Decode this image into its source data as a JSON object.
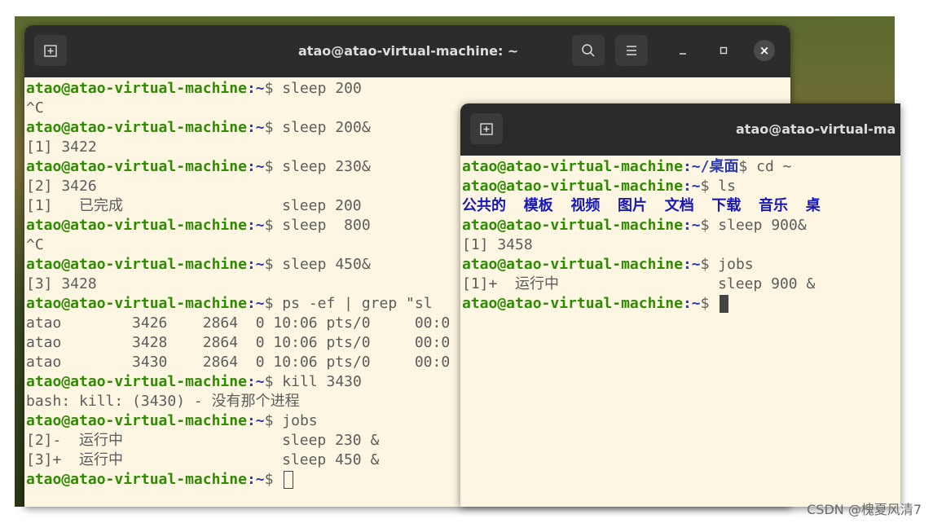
{
  "window1": {
    "title": "atao@atao-virtual-machine: ~",
    "lines": [
      {
        "user": "atao@atao-virtual-machine",
        "path": ":~",
        "cmd": "$ sleep 200"
      },
      {
        "text": "^C"
      },
      {
        "user": "atao@atao-virtual-machine",
        "path": ":~",
        "cmd": "$ sleep 200&"
      },
      {
        "text": "[1] 3422"
      },
      {
        "user": "atao@atao-virtual-machine",
        "path": ":~",
        "cmd": "$ sleep 230&"
      },
      {
        "text": "[2] 3426"
      },
      {
        "text": "[1]   已完成                  sleep 200"
      },
      {
        "user": "atao@atao-virtual-machine",
        "path": ":~",
        "cmd": "$ sleep  800"
      },
      {
        "text": "^C"
      },
      {
        "user": "atao@atao-virtual-machine",
        "path": ":~",
        "cmd": "$ sleep 450&"
      },
      {
        "text": "[3] 3428"
      },
      {
        "user": "atao@atao-virtual-machine",
        "path": ":~",
        "cmd": "$ ps -ef | grep \"sl"
      },
      {
        "text": "atao        3426    2864  0 10:06 pts/0     00:0"
      },
      {
        "text": "atao        3428    2864  0 10:06 pts/0     00:0"
      },
      {
        "text": "atao        3430    2864  0 10:06 pts/0     00:0"
      },
      {
        "user": "atao@atao-virtual-machine",
        "path": ":~",
        "cmd": "$ kill 3430"
      },
      {
        "text": "bash: kill: (3430) - 没有那个进程"
      },
      {
        "user": "atao@atao-virtual-machine",
        "path": ":~",
        "cmd": "$ jobs"
      },
      {
        "text": "[2]-  运行中                  sleep 230 &"
      },
      {
        "text": "[3]+  运行中                  sleep 450 &"
      },
      {
        "user": "atao@atao-virtual-machine",
        "path": ":~",
        "cmd": "$ ",
        "cursor": "box"
      }
    ]
  },
  "window2": {
    "title": "atao@atao-virtual-ma",
    "lines": [
      {
        "user": "atao@atao-virtual-machine",
        "path": ":~/桌面",
        "cmd": "$ cd ~"
      },
      {
        "user": "atao@atao-virtual-machine",
        "path": ":~",
        "cmd": "$ ls"
      },
      {
        "ls": "公共的  模板  视频  图片  文档  下载  音乐  桌"
      },
      {
        "user": "atao@atao-virtual-machine",
        "path": ":~",
        "cmd": "$ sleep 900&"
      },
      {
        "text": "[1] 3458"
      },
      {
        "user": "atao@atao-virtual-machine",
        "path": ":~",
        "cmd": "$ jobs"
      },
      {
        "text": "[1]+  运行中                  sleep 900 &"
      },
      {
        "user": "atao@atao-virtual-machine",
        "path": ":~",
        "cmd": "$ ",
        "cursor": "fill"
      }
    ]
  },
  "icons": {
    "new_tab": "new-tab-icon",
    "search": "search-icon",
    "menu": "hamburger-menu-icon",
    "minimize": "minimize-icon",
    "maximize": "maximize-icon",
    "close": "close-icon"
  },
  "watermark": "CSDN @槐夏风清7",
  "colors": {
    "terminal_bg": "#fdf6e3",
    "user_green": "#2e8c00",
    "path_blue": "#2a3bb5",
    "ls_blue": "#1818b8",
    "titlebar": "#2c2c2c"
  }
}
